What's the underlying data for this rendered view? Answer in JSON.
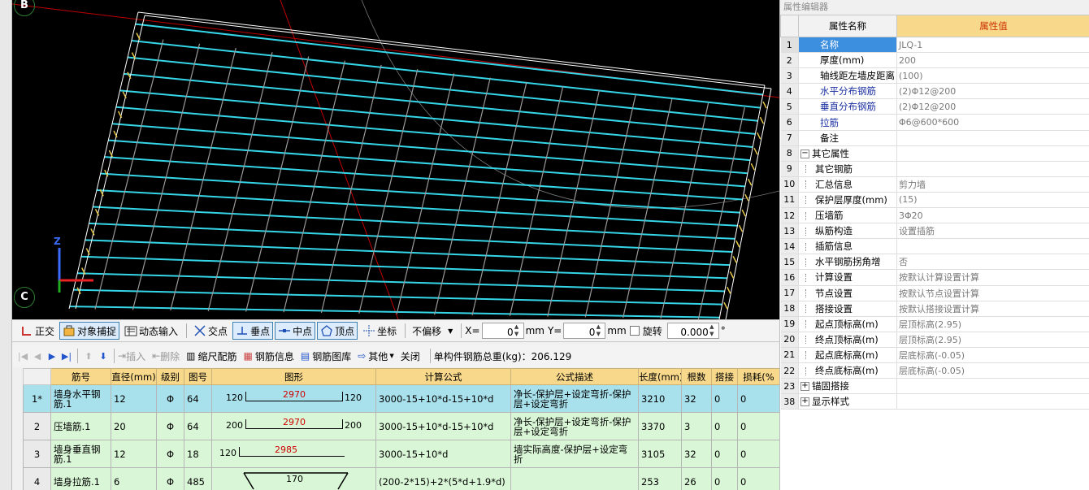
{
  "viewport": {
    "axis_top": "B",
    "axis_bottom": "C",
    "triad_z": "Z"
  },
  "snap_toolbar": {
    "ortho": "正交",
    "object_snap": "对象捕捉",
    "dynamic_input": "动态输入",
    "intersection": "交点",
    "perpendicular": "垂点",
    "midpoint": "中点",
    "vertex": "顶点",
    "coordinate": "坐标",
    "offset_mode": "不偏移",
    "x_label": "X=",
    "x_value": "0",
    "y_label": "Y=",
    "y_value": "0",
    "unit": "mm",
    "rotate_label": "旋转",
    "rotate_value": "0.000",
    "degree": "°"
  },
  "grid_toolbar": {
    "insert": "插入",
    "delete": "删除",
    "scale_rebar": "缩尺配筋",
    "rebar_info": "钢筋信息",
    "rebar_library": "钢筋图库",
    "other": "其他",
    "close": "关闭",
    "total_weight": "单构件钢筋总重(kg)：206.129"
  },
  "rebar_table": {
    "headers": [
      "筋号",
      "直径(mm)",
      "级别",
      "图号",
      "图形",
      "计算公式",
      "公式描述",
      "长度(mm)",
      "根数",
      "搭接",
      "损耗(%"
    ],
    "rows": [
      {
        "idx": "1*",
        "name": "墙身水平钢筋.1",
        "dia": "12",
        "grade": "Φ",
        "fig": "64",
        "left": "120",
        "mid": "2970",
        "right": "120",
        "formula": "3000-15+10*d-15+10*d",
        "desc": "净长-保护层+设定弯折-保护层+设定弯折",
        "length": "3210",
        "count": "32",
        "lap": "0",
        "loss": "0"
      },
      {
        "idx": "2",
        "name": "压墙筋.1",
        "dia": "20",
        "grade": "Φ",
        "fig": "64",
        "left": "200",
        "mid": "2970",
        "right": "200",
        "formula": "3000-15+10*d-15+10*d",
        "desc": "净长-保护层+设定弯折-保护层+设定弯折",
        "length": "3370",
        "count": "3",
        "lap": "0",
        "loss": "0"
      },
      {
        "idx": "3",
        "name": "墙身垂直钢筋.1",
        "dia": "12",
        "grade": "Φ",
        "fig": "18",
        "left": "120",
        "mid": "2985",
        "right": "",
        "formula": "3000-15+10*d",
        "desc": "墙实际高度-保护层+设定弯折",
        "length": "3105",
        "count": "32",
        "lap": "0",
        "loss": "0"
      },
      {
        "idx": "4",
        "name": "墙身拉筋.1",
        "dia": "6",
        "grade": "Φ",
        "fig": "485",
        "left": "",
        "mid": "170",
        "right": "",
        "formula": "(200-2*15)+2*(5*d+1.9*d)",
        "desc": "",
        "length": "253",
        "count": "26",
        "lap": "0",
        "loss": "0"
      }
    ]
  },
  "prop_panel": {
    "title": "属性编辑器",
    "col_name": "属性名称",
    "col_value": "属性值",
    "rows": [
      {
        "idx": "1",
        "name": "名称",
        "value": "JLQ-1",
        "level": 0,
        "blue": false,
        "selected": true
      },
      {
        "idx": "2",
        "name": "厚度(mm)",
        "value": "200",
        "level": 0,
        "blue": false
      },
      {
        "idx": "3",
        "name": "轴线距左墙皮距离",
        "value": "(100)",
        "level": 0,
        "blue": false
      },
      {
        "idx": "4",
        "name": "水平分布钢筋",
        "value": "(2)Φ12@200",
        "level": 0,
        "blue": true
      },
      {
        "idx": "5",
        "name": "垂直分布钢筋",
        "value": "(2)Φ12@200",
        "level": 0,
        "blue": true
      },
      {
        "idx": "6",
        "name": "拉筋",
        "value": "Φ6@600*600",
        "level": 0,
        "blue": true
      },
      {
        "idx": "7",
        "name": "备注",
        "value": "",
        "level": 0,
        "blue": false
      },
      {
        "idx": "8",
        "name": "其它属性",
        "value": "",
        "level": -1,
        "expand": "−"
      },
      {
        "idx": "9",
        "name": "其它钢筋",
        "value": "",
        "level": 1
      },
      {
        "idx": "10",
        "name": "汇总信息",
        "value": "剪力墙",
        "level": 1
      },
      {
        "idx": "11",
        "name": "保护层厚度(mm)",
        "value": "(15)",
        "level": 1
      },
      {
        "idx": "12",
        "name": "压墙筋",
        "value": "3Φ20",
        "level": 1
      },
      {
        "idx": "13",
        "name": "纵筋构造",
        "value": "设置插筋",
        "level": 1
      },
      {
        "idx": "14",
        "name": "插筋信息",
        "value": "",
        "level": 1
      },
      {
        "idx": "15",
        "name": "水平钢筋拐角增",
        "value": "否",
        "level": 1
      },
      {
        "idx": "16",
        "name": "计算设置",
        "value": "按默认计算设置计算",
        "level": 1
      },
      {
        "idx": "17",
        "name": "节点设置",
        "value": "按默认节点设置计算",
        "level": 1
      },
      {
        "idx": "18",
        "name": "搭接设置",
        "value": "按默认搭接设置计算",
        "level": 1
      },
      {
        "idx": "19",
        "name": "起点顶标高(m)",
        "value": "层顶标高(2.95)",
        "level": 1
      },
      {
        "idx": "20",
        "name": "终点顶标高(m)",
        "value": "层顶标高(2.95)",
        "level": 1
      },
      {
        "idx": "21",
        "name": "起点底标高(m)",
        "value": "层底标高(-0.05)",
        "level": 1
      },
      {
        "idx": "22",
        "name": "终点底标高(m)",
        "value": "层底标高(-0.05)",
        "level": 1
      },
      {
        "idx": "23",
        "name": "锚固搭接",
        "value": "",
        "level": -1,
        "expand": "+"
      },
      {
        "idx": "38",
        "name": "显示样式",
        "value": "",
        "level": -1,
        "expand": "+"
      }
    ]
  }
}
